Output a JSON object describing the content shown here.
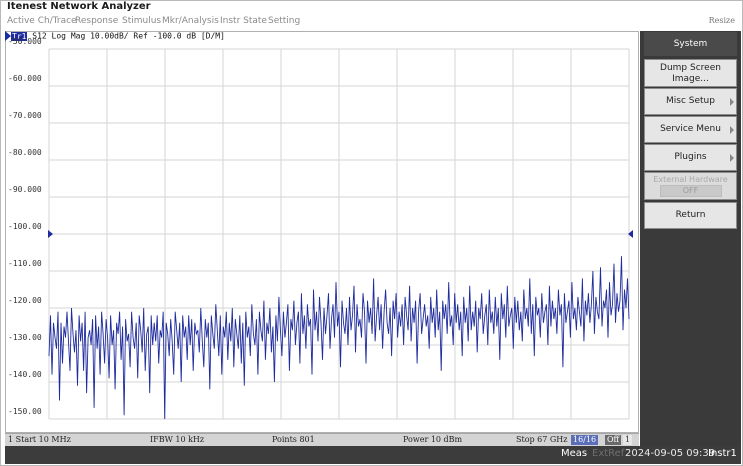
{
  "app": {
    "title": "Itenest Network Analyzer",
    "resize_label": "Resize"
  },
  "menu": [
    "Active Ch/Trace",
    "Response",
    "Stimulus",
    "Mkr/Analysis",
    "Instr State",
    "Setting"
  ],
  "trace": {
    "id": "Tr1",
    "rest": "S12 Log Mag 10.00dB/ Ref  -100.0 dB [D/M]"
  },
  "yaxis_labels": [
    "-50.000",
    "-60.000",
    "-70.000",
    "-80.000",
    "-90.000",
    "-100.00",
    "-110.00",
    "-120.00",
    "-130.00",
    "-140.00",
    "-150.00"
  ],
  "status": {
    "start": "1 Start 10 MHz",
    "ifbw": "IFBW 10 kHz",
    "points": "Points 801",
    "power": "Power 10 dBm",
    "stop": "Stop 67 GHz",
    "avg": "16/16",
    "off": "Off",
    "ch": "1"
  },
  "bottom": {
    "meas": "Meas",
    "extref": "ExtRef",
    "datetime": "2024-09-05 09:39",
    "instr": "Instr1"
  },
  "sidebar": {
    "title": "System",
    "buttons": [
      "Dump Screen Image...",
      "Misc Setup",
      "Service Menu",
      "Plugins"
    ],
    "ext_hw_label": "External Hardware",
    "ext_hw_value": "OFF",
    "return_label": "Return"
  },
  "colors": {
    "trace": "#1f2c9e",
    "sidebar": "#3a3a3a",
    "grid": "#d6d6d6"
  },
  "chart_data": {
    "type": "line",
    "xlabel": "",
    "ylabel": "",
    "x_range_hz": [
      10000000,
      67000000000
    ],
    "ylim": [
      -150,
      -50
    ],
    "y_step_db": 10,
    "grid": true,
    "reference_level_db": -100,
    "series": [
      {
        "values": [
          -133,
          -122,
          -138,
          -124,
          -128,
          -131,
          -121,
          -145,
          -124,
          -135,
          -125,
          -128,
          -121,
          -129,
          -137,
          -120,
          -127,
          -132,
          -126,
          -141,
          -122,
          -129,
          -124,
          -137,
          -121,
          -143,
          -128,
          -126,
          -130,
          -123,
          -147,
          -122,
          -131,
          -125,
          -138,
          -121,
          -127,
          -135,
          -123,
          -128,
          -139,
          -122,
          -130,
          -126,
          -142,
          -124,
          -127,
          -121,
          -134,
          -125,
          -149,
          -123,
          -129,
          -127,
          -136,
          -121,
          -128,
          -131,
          -124,
          -139,
          -122,
          -126,
          -132,
          -120,
          -137,
          -127,
          -125,
          -143,
          -122,
          -130,
          -124,
          -129,
          -122,
          -135,
          -126,
          -128,
          -121,
          -150,
          -124,
          -127,
          -133,
          -123,
          -129,
          -138,
          -121,
          -126,
          -131,
          -124,
          -140,
          -122,
          -128,
          -125,
          -134,
          -122,
          -130,
          -123,
          -137,
          -124,
          -127,
          -126,
          -132,
          -120,
          -129,
          -136,
          -123,
          -128,
          -124,
          -142,
          -122,
          -127,
          -131,
          -119,
          -126,
          -133,
          -122,
          -138,
          -125,
          -128,
          -121,
          -134,
          -124,
          -129,
          -120,
          -136,
          -123,
          -127,
          -131,
          -122,
          -135,
          -124,
          -141,
          -121,
          -128,
          -125,
          -133,
          -119,
          -127,
          -130,
          -123,
          -138,
          -121,
          -126,
          -129,
          -118,
          -134,
          -124,
          -127,
          -120,
          -132,
          -125,
          -140,
          -122,
          -129,
          -117,
          -126,
          -133,
          -121,
          -128,
          -124,
          -119,
          -137,
          -123,
          -126,
          -118,
          -130,
          -124,
          -121,
          -135,
          -116,
          -127,
          -122,
          -131,
          -119,
          -125,
          -123,
          -138,
          -115,
          -126,
          -121,
          -129,
          -117,
          -124,
          -134,
          -120,
          -127,
          -122,
          -116,
          -131,
          -123,
          -119,
          -128,
          -113,
          -125,
          -121,
          -136,
          -118,
          -124,
          -127,
          -120,
          -130,
          -117,
          -126,
          -122,
          -114,
          -132,
          -119,
          -125,
          -123,
          -128,
          -116,
          -121,
          -135,
          -118,
          -124,
          -120,
          -127,
          -112,
          -129,
          -122,
          -117,
          -126,
          -119,
          -131,
          -121,
          -115,
          -124,
          -127,
          -120,
          -133,
          -118,
          -123,
          -116,
          -128,
          -121,
          -125,
          -119,
          -130,
          -117,
          -122,
          -126,
          -114,
          -129,
          -120,
          -124,
          -118,
          -135,
          -121,
          -116,
          -127,
          -123,
          -119,
          -125,
          -122,
          -131,
          -117,
          -124,
          -120,
          -128,
          -115,
          -126,
          -121,
          -137,
          -118,
          -123,
          -119,
          -127,
          -113,
          -125,
          -122,
          -130,
          -116,
          -124,
          -119,
          -126,
          -121,
          -133,
          -117,
          -124,
          -120,
          -129,
          -114,
          -126,
          -121,
          -125,
          -118,
          -132,
          -120,
          -123,
          -116,
          -127,
          -122,
          -119,
          -130,
          -115,
          -124,
          -121,
          -127,
          -117,
          -125,
          -120,
          -134,
          -116,
          -123,
          -119,
          -128,
          -114,
          -125,
          -122,
          -120,
          -131,
          -117,
          -124,
          -118,
          -126,
          -121,
          -129,
          -115,
          -123,
          -120,
          -125,
          -112,
          -127,
          -119,
          -133,
          -117,
          -122,
          -120,
          -128,
          -116,
          -124,
          -121,
          -119,
          -130,
          -114,
          -125,
          -118,
          -123,
          -120,
          -127,
          -115,
          -122,
          -119,
          -136,
          -116,
          -124,
          -121,
          -118,
          -128,
          -113,
          -123,
          -120,
          -126,
          -117,
          -121,
          -125,
          -112,
          -129,
          -118,
          -122,
          -116,
          -124,
          -119,
          -110,
          -127,
          -117,
          -121,
          -123,
          -109,
          -125,
          -118,
          -120,
          -115,
          -128,
          -113,
          -122,
          -119,
          -108,
          -124,
          -116,
          -121,
          -118,
          -106,
          -126,
          -115,
          -120,
          -112,
          -123
        ]
      }
    ]
  }
}
